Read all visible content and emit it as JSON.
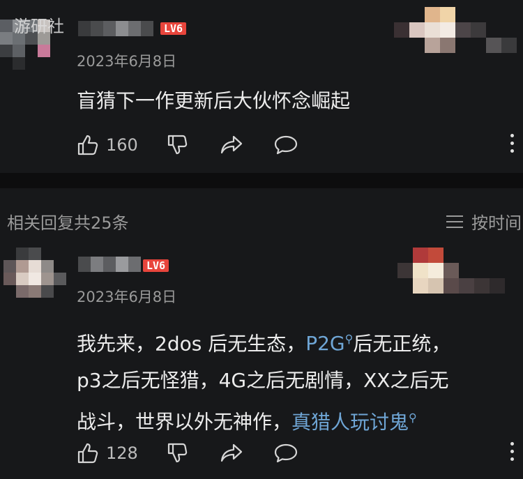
{
  "watermark": "游研社",
  "comments": [
    {
      "level": "LV6",
      "date": "2023年6月8日",
      "text": "盲猜下一作更新后大伙怀念崛起",
      "likes": "160"
    },
    {
      "level": "LV6",
      "date": "2023年6月8日",
      "text_line1_a": "我先来，2dos 后无生态，",
      "text_line1_link": "P2G",
      "text_line1_b": "后无正统，",
      "text_line2": "p3之后无怪猎，4G之后无剧情，XX之后无",
      "text_line3_a": "战斗，世界以外无神作，",
      "text_line3_link": "真猎人玩讨鬼",
      "likes": "128"
    }
  ],
  "replies": {
    "title": "相关回复共25条",
    "sort_label": "按时间"
  },
  "icons": [
    "thumbs-up-icon",
    "thumbs-down-icon",
    "share-icon",
    "comment-icon",
    "more-icon",
    "search-icon",
    "sort-icon"
  ],
  "colors": {
    "background": "#17181a",
    "level_badge": "#e8453c",
    "link": "#6fa6d6"
  }
}
